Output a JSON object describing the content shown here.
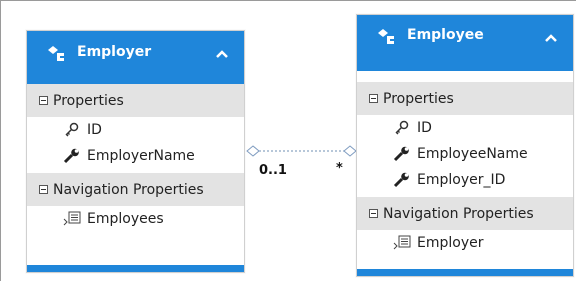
{
  "employer": {
    "title": "Employer",
    "properties_label": "Properties",
    "properties": [
      {
        "name": "ID",
        "icon": "key-icon"
      },
      {
        "name": "EmployerName",
        "icon": "wrench-icon"
      }
    ],
    "navigation_label": "Navigation Properties",
    "navigation": [
      {
        "name": "Employees",
        "icon": "navigation-property-icon"
      }
    ]
  },
  "employee": {
    "title": "Employee",
    "properties_label": "Properties",
    "properties": [
      {
        "name": "ID",
        "icon": "key-icon"
      },
      {
        "name": "EmployeeName",
        "icon": "wrench-icon"
      },
      {
        "name": "Employer_ID",
        "icon": "wrench-icon"
      }
    ],
    "navigation_label": "Navigation Properties",
    "navigation": [
      {
        "name": "Employer",
        "icon": "navigation-property-icon"
      }
    ]
  },
  "association": {
    "left_multiplicity": "0..1",
    "right_multiplicity": "*"
  },
  "colors": {
    "header": "#1f86da",
    "section": "#e3e3e3"
  }
}
